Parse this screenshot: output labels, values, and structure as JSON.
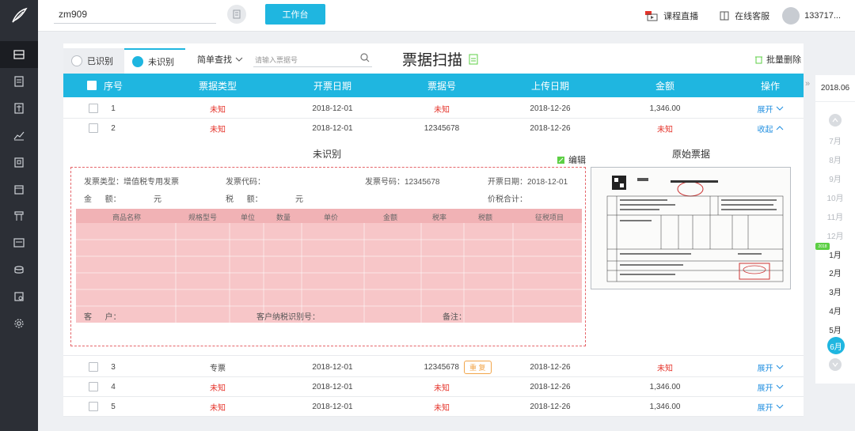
{
  "topbar": {
    "company": "zm909",
    "workbench_label": "工作台",
    "course_live": "课程直播",
    "online_service": "在线客服",
    "user": "133717..."
  },
  "tabs": [
    {
      "label": "已识别"
    },
    {
      "label": "未识别"
    }
  ],
  "search": {
    "mode_label": "简单查找",
    "placeholder": "请输入票据号"
  },
  "page_title": "票据扫描",
  "batch_delete": "批量删除",
  "table": {
    "headers": [
      "序号",
      "票据类型",
      "开票日期",
      "票据号",
      "上传日期",
      "金额",
      "操作"
    ],
    "rows": [
      {
        "no": "1",
        "type": "未知",
        "date": "2018-12-01",
        "number": "未知",
        "upload": "2018-12-26",
        "amount": "1,346.00",
        "action": "展开"
      },
      {
        "no": "2",
        "type": "未知",
        "date": "2018-12-01",
        "number": "12345678",
        "upload": "2018-12-26",
        "amount": "未知",
        "action": "收起"
      },
      {
        "no": "3",
        "type": "专票",
        "date": "2018-12-01",
        "number": "12345678",
        "dup": "重 复",
        "upload": "2018-12-26",
        "amount": "未知",
        "action": "展开"
      },
      {
        "no": "4",
        "type": "未知",
        "date": "2018-12-01",
        "number": "未知",
        "upload": "2018-12-26",
        "amount": "1,346.00",
        "action": "展开"
      },
      {
        "no": "5",
        "type": "未知",
        "date": "2018-12-01",
        "number": "未知",
        "upload": "2018-12-26",
        "amount": "1,346.00",
        "action": "展开"
      }
    ]
  },
  "detail": {
    "title": "未识别",
    "edit": "编辑",
    "orig_title": "原始票据",
    "invoice_type": "发票类型：增值税专用发票",
    "invoice_code": "发票代码：",
    "invoice_number": "发票号码：12345678",
    "invoice_date": "开票日期：2018-12-01",
    "amount_label": "金      额：",
    "amount_unit": "元",
    "tax_label": "税      额：",
    "tax_unit": "元",
    "total_label": "价税合计：",
    "customer": "客      户：",
    "customer_tax_id": "客户纳税识别号：",
    "remark": "备注：",
    "cols": [
      "商品名称",
      "规格型号",
      "单位",
      "数量",
      "单价",
      "金额",
      "税率",
      "税额",
      "征税项目"
    ]
  },
  "timeline": {
    "year": "2018.06",
    "badge": "2018",
    "months": [
      "7月",
      "8月",
      "9月",
      "10月",
      "11月",
      "12月",
      "1月",
      "2月",
      "3月",
      "4月",
      "5月",
      "6月"
    ]
  },
  "colors": {
    "accent": "#1fb6e0",
    "danger": "#e5332a",
    "link": "#1f8ee0"
  }
}
